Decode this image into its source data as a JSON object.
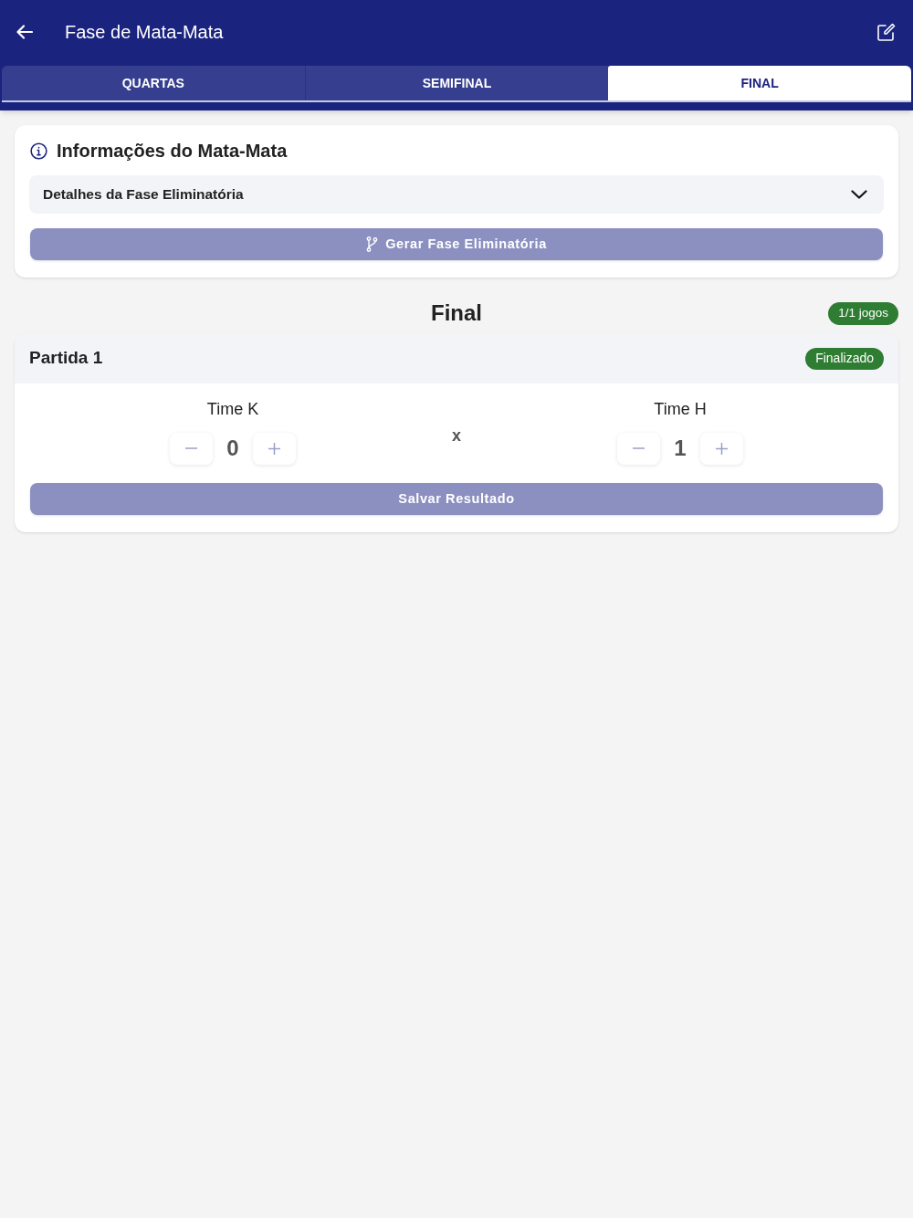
{
  "header": {
    "title": "Fase de Mata-Mata"
  },
  "tabs": [
    {
      "label": "QUARTAS",
      "selected": false
    },
    {
      "label": "SEMIFINAL",
      "selected": false
    },
    {
      "label": "FINAL",
      "selected": true
    }
  ],
  "info_card": {
    "title": "Informações do Mata-Mata",
    "accordion": {
      "label": "Detalhes da Fase Eliminatória",
      "expanded": false
    },
    "generate_button": {
      "label": "Gerar Fase Eliminatória",
      "disabled": true
    }
  },
  "round": {
    "title": "Final",
    "count_badge": "1/1 jogos"
  },
  "matches": [
    {
      "title": "Partida 1",
      "status": "Finalizado",
      "teams": [
        {
          "name": "Time K",
          "score": "0"
        },
        {
          "name": "Time H",
          "score": "1"
        }
      ],
      "separator": "x",
      "save_button": {
        "label": "Salvar Resultado",
        "disabled": true
      }
    }
  ]
}
